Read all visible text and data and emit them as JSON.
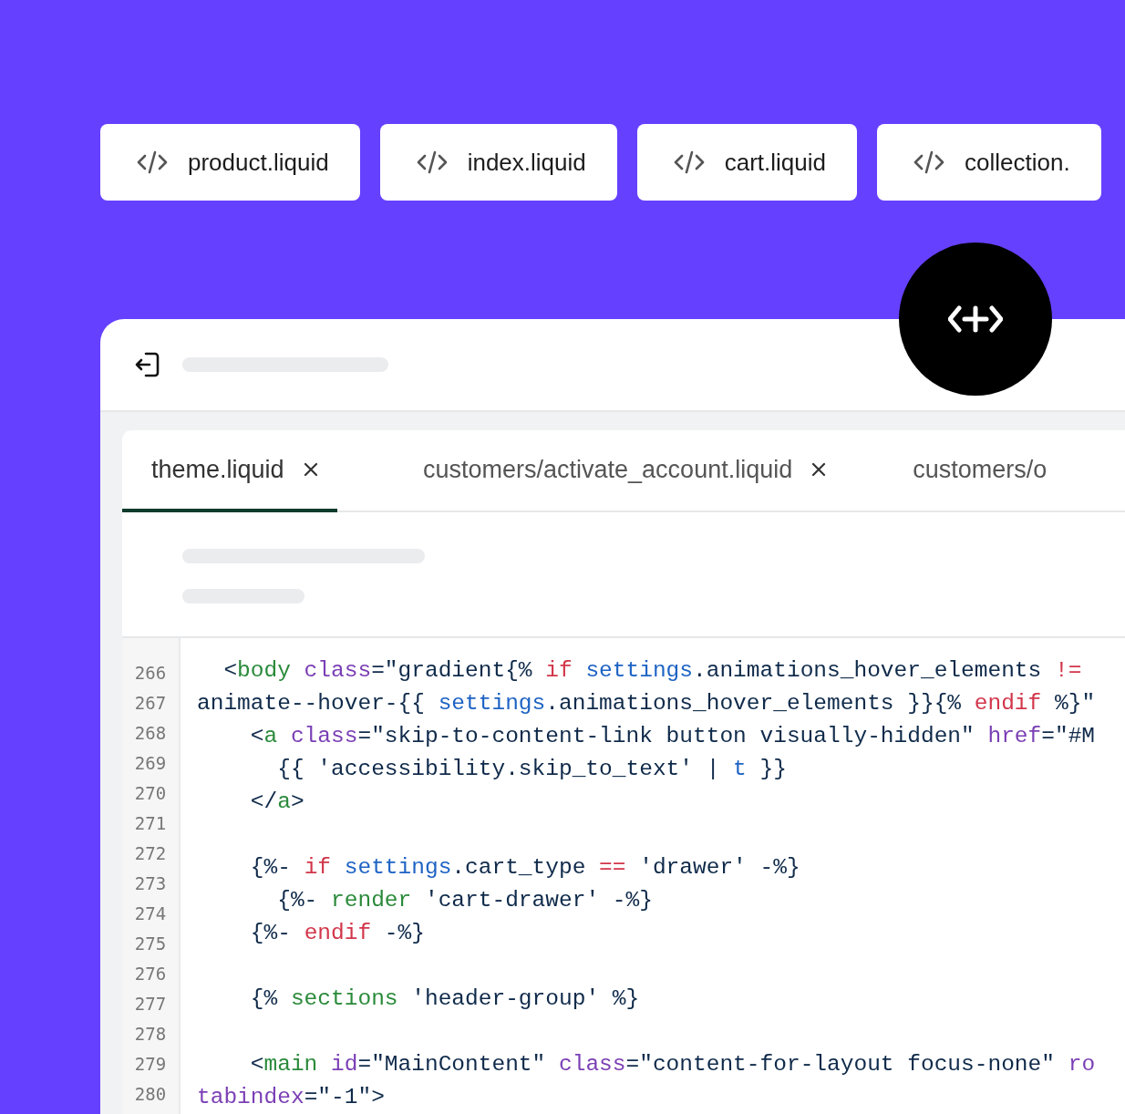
{
  "file_chips": [
    {
      "label": "product.liquid"
    },
    {
      "label": "index.liquid"
    },
    {
      "label": "cart.liquid"
    },
    {
      "label": "collection."
    }
  ],
  "editor": {
    "tabs": [
      {
        "label": "theme.liquid",
        "selected": true,
        "closable": true
      },
      {
        "label": "customers/activate_account.liquid",
        "selected": false,
        "closable": true
      },
      {
        "label": "customers/o",
        "selected": false,
        "closable": false
      }
    ],
    "line_numbers": [
      "266",
      "267",
      "268",
      "269",
      "270",
      "271",
      "272",
      "273",
      "274",
      "275",
      "276",
      "277",
      "278",
      "279",
      "280"
    ],
    "code_lines": [
      {
        "kind": "code",
        "tokens": [
          {
            "kind": "plain",
            "text": "  <"
          },
          {
            "kind": "tag",
            "text": "body"
          },
          {
            "kind": "attr",
            "text": " class"
          },
          {
            "kind": "plain",
            "text": "=\"gradient{% "
          },
          {
            "kind": "keyword",
            "text": "if"
          },
          {
            "kind": "variable",
            "text": " settings"
          },
          {
            "kind": "plain",
            "text": ".animations_hover_elements "
          },
          {
            "kind": "keyword",
            "text": "!="
          }
        ]
      },
      {
        "kind": "code",
        "tokens": [
          {
            "kind": "plain",
            "text": "animate--hover-{{ "
          },
          {
            "kind": "variable",
            "text": "settings"
          },
          {
            "kind": "plain",
            "text": ".animations_hover_elements }}{% "
          },
          {
            "kind": "keyword",
            "text": "endif"
          },
          {
            "kind": "plain",
            "text": " %}\""
          }
        ]
      },
      {
        "kind": "code",
        "tokens": [
          {
            "kind": "plain",
            "text": "    <"
          },
          {
            "kind": "tag",
            "text": "a"
          },
          {
            "kind": "attr",
            "text": " class"
          },
          {
            "kind": "plain",
            "text": "=\"skip-to-content-link button visually-hidden\" "
          },
          {
            "kind": "attr",
            "text": "href"
          },
          {
            "kind": "plain",
            "text": "=\"#M"
          }
        ]
      },
      {
        "kind": "code",
        "tokens": [
          {
            "kind": "plain",
            "text": "      {{ 'accessibility.skip_to_text' | "
          },
          {
            "kind": "variable",
            "text": "t"
          },
          {
            "kind": "plain",
            "text": " }}"
          }
        ]
      },
      {
        "kind": "code",
        "tokens": [
          {
            "kind": "plain",
            "text": "    </"
          },
          {
            "kind": "tag",
            "text": "a"
          },
          {
            "kind": "plain",
            "text": ">"
          }
        ]
      },
      {
        "kind": "blank"
      },
      {
        "kind": "code",
        "tokens": [
          {
            "kind": "plain",
            "text": "    {%- "
          },
          {
            "kind": "keyword",
            "text": "if"
          },
          {
            "kind": "variable",
            "text": " settings"
          },
          {
            "kind": "plain",
            "text": ".cart_type "
          },
          {
            "kind": "keyword",
            "text": "=="
          },
          {
            "kind": "plain",
            "text": " 'drawer' -%}"
          }
        ]
      },
      {
        "kind": "code",
        "tokens": [
          {
            "kind": "plain",
            "text": "      {%- "
          },
          {
            "kind": "tag",
            "text": "render"
          },
          {
            "kind": "plain",
            "text": " 'cart-drawer' -%}"
          }
        ]
      },
      {
        "kind": "code",
        "tokens": [
          {
            "kind": "plain",
            "text": "    {%- "
          },
          {
            "kind": "keyword",
            "text": "endif"
          },
          {
            "kind": "plain",
            "text": " -%}"
          }
        ]
      },
      {
        "kind": "blank"
      },
      {
        "kind": "code",
        "tokens": [
          {
            "kind": "plain",
            "text": "    {% "
          },
          {
            "kind": "tag",
            "text": "sections"
          },
          {
            "kind": "plain",
            "text": " 'header-group' %}"
          }
        ]
      },
      {
        "kind": "blank"
      },
      {
        "kind": "code",
        "tokens": [
          {
            "kind": "plain",
            "text": "    <"
          },
          {
            "kind": "tag",
            "text": "main"
          },
          {
            "kind": "attr",
            "text": " id"
          },
          {
            "kind": "plain",
            "text": "=\"MainContent\" "
          },
          {
            "kind": "attr",
            "text": "class"
          },
          {
            "kind": "plain",
            "text": "=\"content-for-layout focus-none\" "
          },
          {
            "kind": "attr",
            "text": "ro"
          }
        ]
      },
      {
        "kind": "code",
        "tokens": [
          {
            "kind": "attr",
            "text": "tabindex"
          },
          {
            "kind": "plain",
            "text": "=\"-1\">"
          }
        ]
      }
    ]
  }
}
